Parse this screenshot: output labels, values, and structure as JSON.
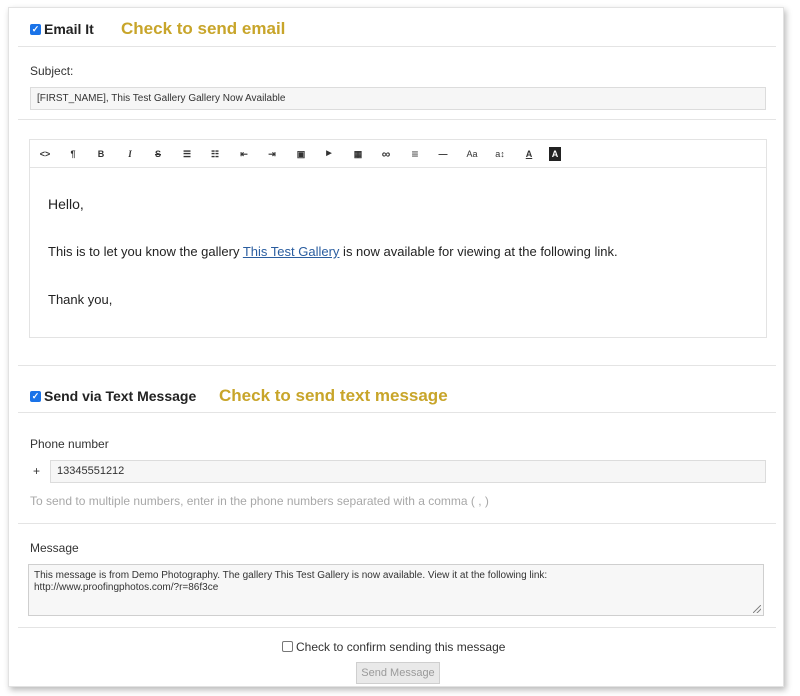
{
  "email_section": {
    "checkbox_label": "Email It",
    "hint": "Check to send email",
    "subject_label": "Subject:",
    "subject_value": "[FIRST_NAME], This Test Gallery Gallery Now Available",
    "toolbar": [
      {
        "glyph": "<>",
        "icon": "code-view-icon"
      },
      {
        "glyph": "¶",
        "icon": "paragraph-icon"
      },
      {
        "glyph": "B",
        "icon": "bold-icon"
      },
      {
        "glyph": "I",
        "icon": "italic-icon"
      },
      {
        "glyph": "S",
        "icon": "strikethrough-icon"
      },
      {
        "glyph": "☰",
        "icon": "unordered-list-icon"
      },
      {
        "glyph": "☷",
        "icon": "ordered-list-icon"
      },
      {
        "glyph": "⇤",
        "icon": "outdent-icon"
      },
      {
        "glyph": "⇥",
        "icon": "indent-icon"
      },
      {
        "glyph": "▣",
        "icon": "image-icon"
      },
      {
        "glyph": "▶",
        "icon": "video-icon"
      },
      {
        "glyph": "▦",
        "icon": "table-icon"
      },
      {
        "glyph": "∞",
        "icon": "link-icon"
      },
      {
        "glyph": "≡",
        "icon": "align-icon"
      },
      {
        "glyph": "—",
        "icon": "horizontal-rule-icon"
      },
      {
        "glyph": "Aa",
        "icon": "font-size-icon"
      },
      {
        "glyph": "a↕",
        "icon": "line-height-icon"
      },
      {
        "glyph": "A",
        "icon": "font-color-icon"
      },
      {
        "glyph": "A",
        "icon": "background-color-icon"
      }
    ],
    "body": {
      "greeting": "Hello,",
      "line_before_link": "This is to let you know the gallery ",
      "link_text": "This Test Gallery",
      "line_after_link": " is now available for viewing at the following link.",
      "closing": "Thank you,"
    }
  },
  "text_section": {
    "checkbox_label": "Send via Text Message",
    "hint": "Check to send text message",
    "phone_label": "Phone number",
    "phone_prefix": "+",
    "phone_value": "13345551212",
    "phone_hint": "To send to multiple numbers, enter in the phone numbers separated with a comma ( , )",
    "message_label": "Message",
    "message_line1": "This message is from Demo Photography. The gallery This Test Gallery is now available. View it at the following link:",
    "message_line2": "http://www.proofingphotos.com/?r=86f3ce"
  },
  "confirm": {
    "label": "Check to confirm sending this message",
    "send_button": "Send Message"
  },
  "colors": {
    "hint": "#c8a52a",
    "checkbox": "#1a73e8",
    "link": "#2a5d9f"
  }
}
